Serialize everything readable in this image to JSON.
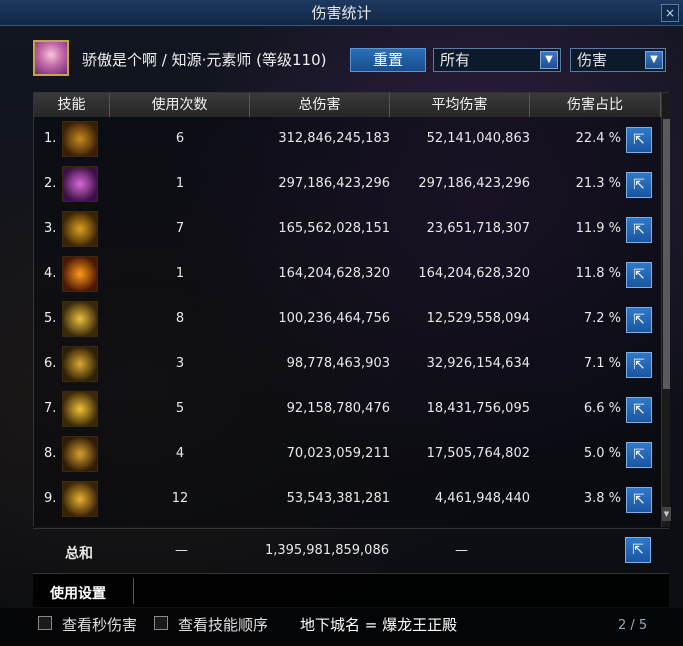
{
  "window": {
    "title": "伤害统计",
    "close_label": "×"
  },
  "header": {
    "character_label": "骄傲是个啊 / 知源·元素师 (等级110)",
    "reset_label": "重置",
    "filter_target": "所有",
    "filter_type": "伤害"
  },
  "table": {
    "columns": [
      "技能",
      "使用次数",
      "总伤害",
      "平均伤害",
      "伤害占比"
    ],
    "rows": [
      {
        "rank": "1.",
        "icon": "vortex-skill-icon",
        "count": "6",
        "total": "312,846,245,183",
        "avg": "52,141,040,863",
        "pct": "22.4 %",
        "icon_colors": [
          "#c98a1f",
          "#3a1f05"
        ]
      },
      {
        "rank": "2.",
        "icon": "dome-skill-icon",
        "count": "1",
        "total": "297,186,423,296",
        "avg": "297,186,423,296",
        "pct": "21.3 %",
        "icon_colors": [
          "#d66ad8",
          "#3b0f44"
        ]
      },
      {
        "rank": "3.",
        "icon": "flame-pillar-skill-icon",
        "count": "7",
        "total": "165,562,028,151",
        "avg": "23,651,718,307",
        "pct": "11.9 %",
        "icon_colors": [
          "#e0a020",
          "#3a2405"
        ]
      },
      {
        "rank": "4.",
        "icon": "burst-skill-icon",
        "count": "1",
        "total": "164,204,628,320",
        "avg": "164,204,628,320",
        "pct": "11.8 %",
        "icon_colors": [
          "#ff9a1a",
          "#4a1605"
        ]
      },
      {
        "rank": "5.",
        "icon": "blade-skill-icon",
        "count": "8",
        "total": "100,236,464,756",
        "avg": "12,529,558,094",
        "pct": "7.2 %",
        "icon_colors": [
          "#e8c040",
          "#3a2808"
        ]
      },
      {
        "rank": "6.",
        "icon": "slash-skill-icon",
        "count": "3",
        "total": "98,778,463,903",
        "avg": "32,926,154,634",
        "pct": "7.1 %",
        "icon_colors": [
          "#d9a832",
          "#2e1e05"
        ]
      },
      {
        "rank": "7.",
        "icon": "star-skill-icon",
        "count": "5",
        "total": "92,158,780,476",
        "avg": "18,431,756,095",
        "pct": "6.6 %",
        "icon_colors": [
          "#f0c038",
          "#3a2808"
        ]
      },
      {
        "rank": "8.",
        "icon": "halo-skill-icon",
        "count": "4",
        "total": "70,023,059,211",
        "avg": "17,505,764,802",
        "pct": "5.0 %",
        "icon_colors": [
          "#d8a030",
          "#2e1a05"
        ]
      },
      {
        "rank": "9.",
        "icon": "ring-skill-icon",
        "count": "12",
        "total": "53,543,381,281",
        "avg": "4,461,948,440",
        "pct": "3.8 %",
        "icon_colors": [
          "#e8b030",
          "#3a2206"
        ]
      }
    ],
    "share_label": "⇱"
  },
  "summary": {
    "label": "总和",
    "count": "—",
    "total": "1,395,981,859,086",
    "avg": "—"
  },
  "settings": {
    "label": "使用设置"
  },
  "bottom": {
    "check1_label": "查看秒伤害",
    "check2_label": "查看技能顺序",
    "dungeon_label": "地下城名 = 爆龙王正殿",
    "page_label": "2 / 5"
  }
}
